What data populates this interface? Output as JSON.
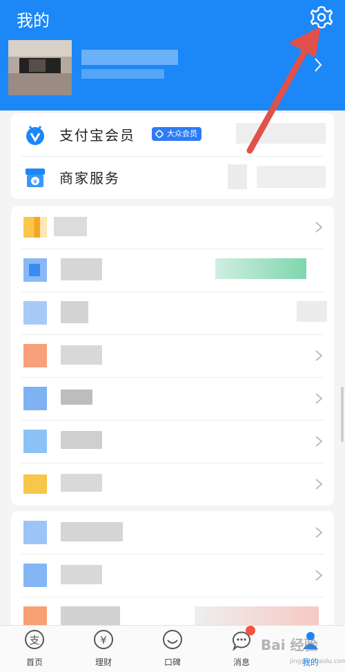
{
  "header": {
    "title": "我的",
    "settings_icon": "gear-icon",
    "background": "#1c87f7"
  },
  "services": {
    "items": [
      {
        "label": "支付宝会员",
        "icon": "member-shield-icon",
        "badge": "大众会员"
      },
      {
        "label": "商家服务",
        "icon": "merchant-store-icon"
      }
    ]
  },
  "tabbar": {
    "items": [
      {
        "label": "首页",
        "icon": "alipay-home-icon",
        "active": false
      },
      {
        "label": "理财",
        "icon": "wealth-yuan-icon",
        "active": false
      },
      {
        "label": "口碑",
        "icon": "koubei-smile-icon",
        "active": false
      },
      {
        "label": "消息",
        "icon": "message-bubble-icon",
        "active": false,
        "has_dot": true
      },
      {
        "label": "我的",
        "icon": "profile-person-icon",
        "active": true
      }
    ]
  },
  "annotation": {
    "color": "#e0514a"
  },
  "watermark": {
    "text": "Bai 经验",
    "sub": "jingyan.baidu.com"
  }
}
